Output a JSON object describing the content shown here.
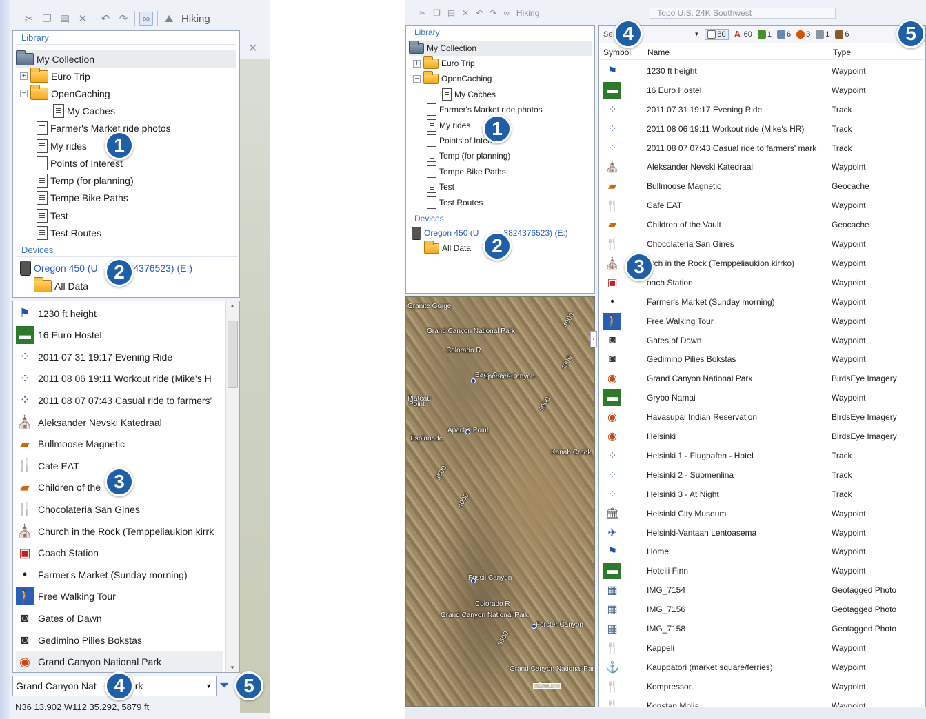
{
  "callouts": [
    "1",
    "2",
    "3",
    "4",
    "5"
  ],
  "toolbar": {
    "activity": "Hiking",
    "right_activity": "Hiking",
    "right_search": "Topo U.S. 24K Southwest"
  },
  "library": {
    "title": "Library",
    "root": "My Collection",
    "items": [
      "Euro Trip",
      "OpenCaching",
      "My Caches",
      "Farmer's Market ride photos",
      "My rides",
      "Points of Interest",
      "Temp (for planning)",
      "Tempe Bike Paths",
      "Test",
      "Test Routes"
    ]
  },
  "devices": {
    "title": "Devices",
    "device": "Oregon 450 (Unit ID 3824376523) (E:)",
    "device_left_a": "Oregon 450 (U",
    "device_left_b": "24376523) (E:)",
    "device_right_a": "Oregon 450 (U",
    "device_right_b": "3824376523) (E:)",
    "all_data": "All Data"
  },
  "left_list": [
    {
      "name": "1230 ft height",
      "icon": "flag-icon"
    },
    {
      "name": "16 Euro Hostel",
      "icon": "lodging-icon"
    },
    {
      "name": "2011 07 31 19:17 Evening Ride",
      "icon": "track-icon"
    },
    {
      "name": "2011 08 06 19:11 Workout ride (Mike's H",
      "icon": "track-icon"
    },
    {
      "name": "2011 08 07 07:43 Casual ride to farmers'",
      "icon": "track-icon"
    },
    {
      "name": "Aleksander Nevski Katedraal",
      "icon": "church-icon"
    },
    {
      "name": "Bullmoose Magnetic",
      "icon": "geocache-icon"
    },
    {
      "name": "Cafe EAT",
      "icon": "restaurant-icon"
    },
    {
      "name": "Children of the",
      "icon": "geocache-icon"
    },
    {
      "name": "Chocolateria San Gines",
      "icon": "restaurant-icon"
    },
    {
      "name": "Church in the Rock (Temppeliaukion kirrk",
      "icon": "church-icon"
    },
    {
      "name": "Coach Station",
      "icon": "bus-icon"
    },
    {
      "name": "Farmer's Market (Sunday morning)",
      "icon": "dot-icon"
    },
    {
      "name": "Free Walking Tour",
      "icon": "walking-icon"
    },
    {
      "name": "Gates of Dawn",
      "icon": "camera-icon"
    },
    {
      "name": "Gedimino Pilies Bokstas",
      "icon": "camera-icon"
    },
    {
      "name": "Grand Canyon National Park",
      "icon": "birdseye-icon"
    }
  ],
  "left_search": {
    "value": "Grand Canyon Nat",
    "tail": "rk"
  },
  "left_status": "N36 13.902 W112 35.292, 5879 ft",
  "map_labels": [
    "Granite Gorge",
    "Grand Canyon National Park",
    "Colorado R",
    "Bass Camp",
    "Plateau",
    "Point",
    "Spencer Canyon",
    "Apache Point",
    "Esplanade",
    "Fossil Canyon",
    "Colorado R",
    "Grand Canyon National Park",
    "Forster Canyon",
    "Kanab Creek",
    "Grand Canyon National Park",
    "2 mi",
    "4000",
    "4500",
    "5000",
    "3500",
    "4000",
    "3500"
  ],
  "right_list_toolbar": {
    "search_stub": "Se",
    "filters": [
      "80",
      "60",
      "1",
      "6",
      "3",
      "1",
      "6"
    ]
  },
  "columns": {
    "symbol": "Symbol",
    "name": "Name",
    "type": "Type"
  },
  "right_list": [
    {
      "name": "1230 ft height",
      "type": "Waypoint",
      "icon": "flag-icon"
    },
    {
      "name": "16 Euro Hostel",
      "type": "Waypoint",
      "icon": "lodging-icon"
    },
    {
      "name": "2011 07 31 19:17 Evening Ride",
      "type": "Track",
      "icon": "track-icon"
    },
    {
      "name": "2011 08 06 19:11 Workout ride (Mike's HR)",
      "type": "Track",
      "icon": "track-icon"
    },
    {
      "name": "2011 08 07 07:43 Casual ride to farmers' mark",
      "type": "Track",
      "icon": "track-icon"
    },
    {
      "name": "Aleksander Nevski Katedraal",
      "type": "Waypoint",
      "icon": "church-icon"
    },
    {
      "name": "Bullmoose Magnetic",
      "type": "Geocache",
      "icon": "geocache-icon"
    },
    {
      "name": "Cafe EAT",
      "type": "Waypoint",
      "icon": "restaurant-icon"
    },
    {
      "name": "Children of the Vault",
      "type": "Geocache",
      "icon": "geocache-icon"
    },
    {
      "name": "Chocolateria San Gines",
      "type": "Waypoint",
      "icon": "restaurant-icon"
    },
    {
      "name": "urch in the Rock (Temppeliaukion kirrko)",
      "type": "Waypoint",
      "icon": "church-icon"
    },
    {
      "name": "oach Station",
      "type": "Waypoint",
      "icon": "bus-icon"
    },
    {
      "name": "Farmer's Market (Sunday morning)",
      "type": "Waypoint",
      "icon": "dot-icon"
    },
    {
      "name": "Free Walking Tour",
      "type": "Waypoint",
      "icon": "walking-icon"
    },
    {
      "name": "Gates of Dawn",
      "type": "Waypoint",
      "icon": "camera-icon"
    },
    {
      "name": "Gedimino Pilies Bokstas",
      "type": "Waypoint",
      "icon": "camera-icon"
    },
    {
      "name": "Grand Canyon National Park",
      "type": "BirdsEye Imagery",
      "icon": "birdseye-icon"
    },
    {
      "name": "Grybo Namai",
      "type": "Waypoint",
      "icon": "lodging-icon"
    },
    {
      "name": "Havasupai Indian Reservation",
      "type": "BirdsEye Imagery",
      "icon": "birdseye-icon"
    },
    {
      "name": "Helsinki",
      "type": "BirdsEye Imagery",
      "icon": "birdseye-icon"
    },
    {
      "name": "Helsinki 1 - Flughafen - Hotel",
      "type": "Track",
      "icon": "track-icon"
    },
    {
      "name": "Helsinki 2 - Suomenlina",
      "type": "Track",
      "icon": "track-icon"
    },
    {
      "name": "Helsinki 3 - At Night",
      "type": "Track",
      "icon": "track-icon"
    },
    {
      "name": "Helsinki City Museum",
      "type": "Waypoint",
      "icon": "museum-icon"
    },
    {
      "name": "Helsinki-Vantaan Lentoasema",
      "type": "Waypoint",
      "icon": "airport-icon"
    },
    {
      "name": "Home",
      "type": "Waypoint",
      "icon": "flag-icon"
    },
    {
      "name": "Hotelli Finn",
      "type": "Waypoint",
      "icon": "lodging-icon"
    },
    {
      "name": "IMG_7154",
      "type": "Geotagged Photo",
      "icon": "photo-icon"
    },
    {
      "name": "IMG_7156",
      "type": "Geotagged Photo",
      "icon": "photo-icon"
    },
    {
      "name": "IMG_7158",
      "type": "Geotagged Photo",
      "icon": "photo-icon"
    },
    {
      "name": "Kappeli",
      "type": "Waypoint",
      "icon": "restaurant-icon"
    },
    {
      "name": "Kauppatori (market square/ferries)",
      "type": "Waypoint",
      "icon": "anchor-icon"
    },
    {
      "name": "Kompressor",
      "type": "Waypoint",
      "icon": "restaurant-icon"
    },
    {
      "name": "Konstan Molja",
      "type": "Waypoint",
      "icon": "restaurant-icon"
    }
  ]
}
